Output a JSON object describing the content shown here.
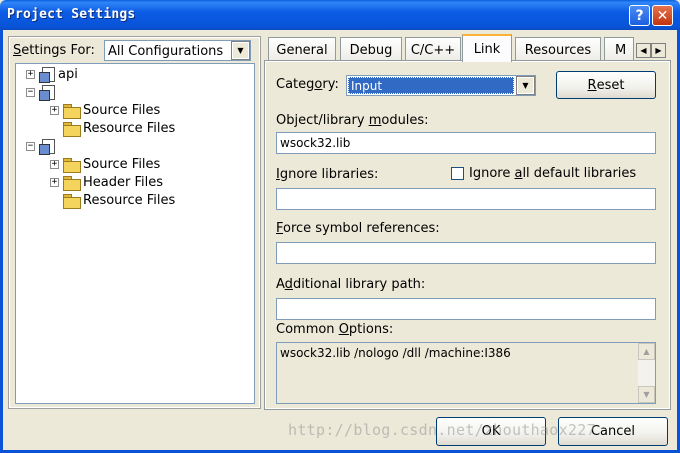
{
  "window": {
    "title": "Project Settings",
    "help_glyph": "?",
    "close_glyph": "✕"
  },
  "settings_for": {
    "label_u": "S",
    "label_rest": "ettings For:",
    "value": "All Configurations"
  },
  "tree": {
    "items": [
      {
        "label": "api",
        "kind": "project",
        "expander": "+"
      },
      {
        "label": "",
        "kind": "project",
        "expander": "−"
      },
      {
        "label": "Source Files",
        "kind": "folder",
        "expander": "+"
      },
      {
        "label": "Resource Files",
        "kind": "folder",
        "expander": ""
      },
      {
        "label": "",
        "kind": "project",
        "expander": "−"
      },
      {
        "label": "Source Files",
        "kind": "folder",
        "expander": "+"
      },
      {
        "label": "Header Files",
        "kind": "folder",
        "expander": "+"
      },
      {
        "label": "Resource Files",
        "kind": "folder",
        "expander": ""
      }
    ]
  },
  "tabs": {
    "items": [
      "General",
      "Debug",
      "C/C++",
      "Link",
      "Resources",
      "M"
    ],
    "active": "Link",
    "scroll_left": "◀",
    "scroll_right": "▶"
  },
  "link": {
    "category_label_a": "Categ",
    "category_label_u": "o",
    "category_label_b": "ry:",
    "category_value": "Input",
    "reset_u": "R",
    "reset_rest": "eset",
    "modules_label_a": "Object/library ",
    "modules_label_u": "m",
    "modules_label_b": "odules:",
    "modules_value": "wsock32.lib",
    "ignore_label_u": "I",
    "ignore_label_rest": "gnore libraries:",
    "ignore_value": "",
    "ignore_all_a": "Ignore ",
    "ignore_all_u": "a",
    "ignore_all_b": "ll default libraries",
    "ignore_all_checked": false,
    "force_label_u": "F",
    "force_label_rest": "orce symbol references:",
    "force_value": "",
    "path_label_a": "A",
    "path_label_u": "d",
    "path_label_b": "ditional library path:",
    "path_value": "",
    "common_label_a": "Common ",
    "common_label_u": "O",
    "common_label_b": "ptions:",
    "common_value": "wsock32.lib /nologo /dll /machine:I386"
  },
  "buttons": {
    "ok": "OK",
    "cancel": "Cancel"
  },
  "watermark": "http://blog.csdn.net/zhouthaox227",
  "colors": {
    "titlebar": "#0a5fe0",
    "selection": "#316ac5",
    "dialog_bg": "#ece9d8"
  }
}
